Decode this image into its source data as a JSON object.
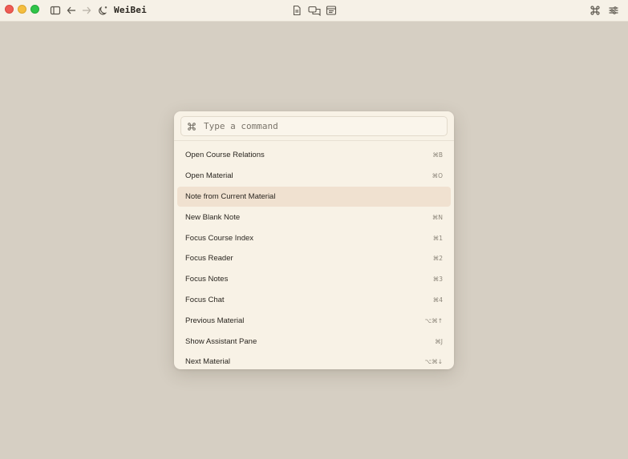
{
  "app": {
    "title": "WeiBei"
  },
  "palette": {
    "placeholder": "Type a command",
    "items": [
      {
        "label": "Open Course Relations",
        "shortcut": "⌘B",
        "active": false
      },
      {
        "label": "Open Material",
        "shortcut": "⌘O",
        "active": false
      },
      {
        "label": "Note from Current Material",
        "shortcut": "",
        "active": true
      },
      {
        "label": "New Blank Note",
        "shortcut": "⌘N",
        "active": false
      },
      {
        "label": "Focus Course Index",
        "shortcut": "⌘1",
        "active": false
      },
      {
        "label": "Focus Reader",
        "shortcut": "⌘2",
        "active": false
      },
      {
        "label": "Focus Notes",
        "shortcut": "⌘3",
        "active": false
      },
      {
        "label": "Focus Chat",
        "shortcut": "⌘4",
        "active": false
      },
      {
        "label": "Previous Material",
        "shortcut": "⌥⌘↑",
        "active": false
      },
      {
        "label": "Show Assistant Pane",
        "shortcut": "⌘J",
        "active": false
      },
      {
        "label": "Next Material",
        "shortcut": "⌥⌘↓",
        "active": false
      }
    ]
  }
}
